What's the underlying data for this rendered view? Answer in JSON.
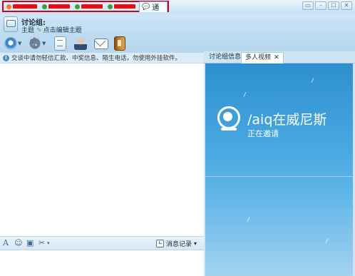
{
  "tabs": {
    "active_label": "普通讨",
    "redacted_count": 4
  },
  "window": {
    "controls": [
      "▭",
      "–",
      "☐",
      "✕"
    ]
  },
  "group": {
    "name": "讨论组:",
    "subject_label": "主题",
    "subject_hint": "点击编辑主题"
  },
  "notice": {
    "text": "交谈中请勿轻信汇款、中奖信息、陌生电话，勿使用外挂软件。"
  },
  "input_toolbar": {
    "font_icon": "A",
    "history_label": "消息记录",
    "history_caret": "▾"
  },
  "side_tabs": {
    "info_label": "讨论组信息",
    "video_label": "多人视频",
    "close_glyph": "✕"
  },
  "video": {
    "name": "/aiq在威尼斯",
    "status": "正在邀请"
  },
  "colors": {
    "redaction": "#e01212",
    "tab_highlight": "#d0021b",
    "video_bg": "#3a9bd8"
  }
}
